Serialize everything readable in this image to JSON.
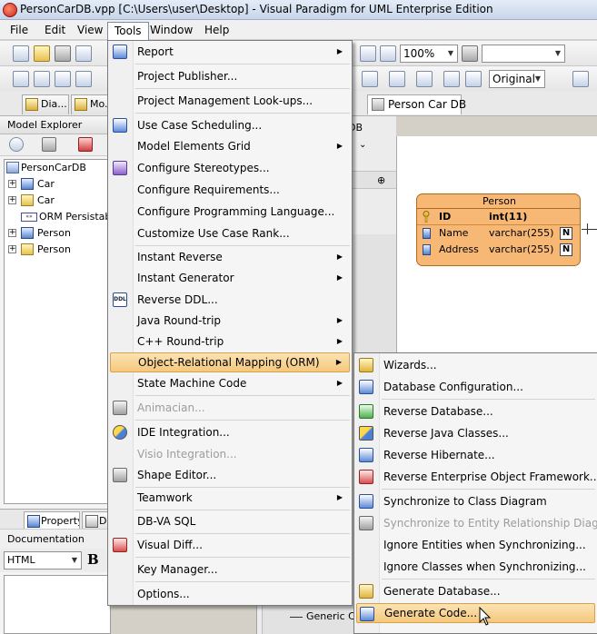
{
  "window": {
    "title": "PersonCarDB.vpp [C:\\Users\\user\\Desktop] - Visual Paradigm for UML Enterprise Edition"
  },
  "menubar": [
    "File",
    "Edit",
    "View",
    "Tools",
    "Window",
    "Help"
  ],
  "toolbar": {
    "zoom": "100%",
    "style": "Original"
  },
  "tabs": {
    "left": [
      "Dia...",
      "Mo..."
    ],
    "diagram": "Person Car DB",
    "mid_header_fragment": "DB"
  },
  "explorer": {
    "title": "Model Explorer",
    "tree": [
      {
        "label": "PersonCarDB",
        "icon": "database-icon"
      },
      {
        "label": "Car",
        "icon": "table-icon"
      },
      {
        "label": "Car",
        "icon": "package-icon"
      },
      {
        "label": "ORM Persistable",
        "icon": "orm-icon"
      },
      {
        "label": "Person",
        "icon": "table-icon"
      },
      {
        "label": "Person",
        "icon": "package-icon"
      }
    ],
    "bottom_tabs": [
      "Property",
      "D"
    ],
    "doc_title": "Documentation",
    "doc_format": "HTML",
    "bold": "B"
  },
  "mid_panel": {
    "row1_fragment": "ship",
    "bottom_fragment": "Generic Conn"
  },
  "entity": {
    "title": "Person",
    "rows": [
      {
        "name": "ID",
        "type": "int(11)",
        "pk": true,
        "nullable": ""
      },
      {
        "name": "Name",
        "type": "varchar(255)",
        "pk": false,
        "nullable": "N"
      },
      {
        "name": "Address",
        "type": "varchar(255)",
        "pk": false,
        "nullable": "N"
      }
    ]
  },
  "tools_menu": [
    {
      "label": "Report",
      "submenu": true,
      "icon": "report-icon"
    },
    {
      "label": "Project Publisher...",
      "sep_before": true
    },
    {
      "label": "Project Management Look-ups...",
      "sep_before": true
    },
    {
      "label": "Use Case Scheduling...",
      "sep_before": true,
      "icon": "schedule-icon"
    },
    {
      "label": "Model Elements Grid",
      "submenu": true
    },
    {
      "label": "Configure Stereotypes...",
      "icon": "stereotype-icon"
    },
    {
      "label": "Configure Requirements..."
    },
    {
      "label": "Configure Programming Language..."
    },
    {
      "label": "Customize Use Case Rank..."
    },
    {
      "label": "Instant Reverse",
      "submenu": true,
      "sep_before": true
    },
    {
      "label": "Instant Generator",
      "submenu": true
    },
    {
      "label": "Reverse DDL...",
      "icon": "ddl-icon"
    },
    {
      "label": "Java Round-trip",
      "submenu": true
    },
    {
      "label": "C++ Round-trip",
      "submenu": true
    },
    {
      "label": "Object-Relational Mapping (ORM)",
      "submenu": true,
      "highlight": true
    },
    {
      "label": "State Machine Code",
      "submenu": true
    },
    {
      "label": "Animacian...",
      "disabled": true,
      "sep_before": true,
      "icon": "animacian-icon"
    },
    {
      "label": "IDE Integration...",
      "sep_before": true,
      "icon": "ide-icon"
    },
    {
      "label": "Visio Integration...",
      "disabled": true
    },
    {
      "label": "Shape Editor...",
      "icon": "shape-editor-icon"
    },
    {
      "label": "Teamwork",
      "submenu": true,
      "sep_before": true
    },
    {
      "label": "DB-VA SQL",
      "sep_before": true
    },
    {
      "label": "Visual Diff...",
      "sep_before": true,
      "icon": "visual-diff-icon"
    },
    {
      "label": "Key Manager...",
      "sep_before": true
    },
    {
      "label": "Options...",
      "sep_before": true
    }
  ],
  "orm_submenu": [
    {
      "label": "Wizards...",
      "icon": "wizard-icon"
    },
    {
      "label": "Database Configuration...",
      "icon": "db-config-icon"
    },
    {
      "label": "Reverse Database...",
      "sep_before": true,
      "icon": "reverse-db-icon"
    },
    {
      "label": "Reverse Java Classes...",
      "icon": "reverse-java-icon"
    },
    {
      "label": "Reverse Hibernate...",
      "icon": "reverse-hibernate-icon"
    },
    {
      "label": "Reverse Enterprise Object Framework...",
      "icon": "reverse-eof-icon"
    },
    {
      "label": "Synchronize to Class Diagram",
      "sep_before": true,
      "icon": "sync-class-icon"
    },
    {
      "label": "Synchronize to Entity Relationship Diagram",
      "disabled": true,
      "icon": "sync-erd-icon"
    },
    {
      "label": "Ignore Entities when Synchronizing..."
    },
    {
      "label": "Ignore Classes when Synchronizing..."
    },
    {
      "label": "Generate Database...",
      "sep_before": true,
      "icon": "generate-db-icon"
    },
    {
      "label": "Generate Code...",
      "highlight": true,
      "icon": "generate-code-icon"
    }
  ]
}
